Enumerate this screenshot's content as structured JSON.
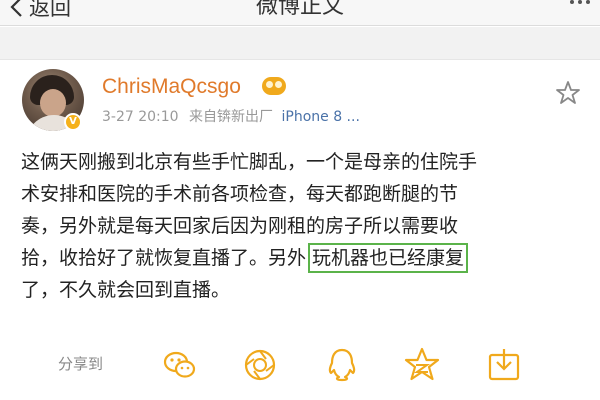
{
  "nav": {
    "back_label": "返回",
    "title": "微博正文"
  },
  "post": {
    "username": "ChrisMaQcsgo",
    "time": "3-27 20:10",
    "source_prefix": "来自锛新出厂",
    "device": "iPhone 8 ...",
    "body_lines": [
      "这俩天刚搬到北京有些手忙脚乱，一个是母亲的住院手",
      "术安排和医院的手术前各项检查，每天都跑断腿的节",
      "奏，另外就是每天回家后因为刚租的房子所以需要收",
      "拾，收拾好了就恢复直播了。另外",
      "了，不久就会回到直播。"
    ],
    "highlighted_text": "玩机器也已经康复"
  },
  "share": {
    "label": "分享到",
    "targets": [
      "wechat-icon",
      "moments-icon",
      "qq-icon",
      "qzone-icon",
      "save-icon"
    ]
  },
  "colors": {
    "username": "#e07a2b",
    "highlight_border": "#5bb34a",
    "share_icon": "#f0a91c",
    "device_link": "#4a72a8"
  }
}
